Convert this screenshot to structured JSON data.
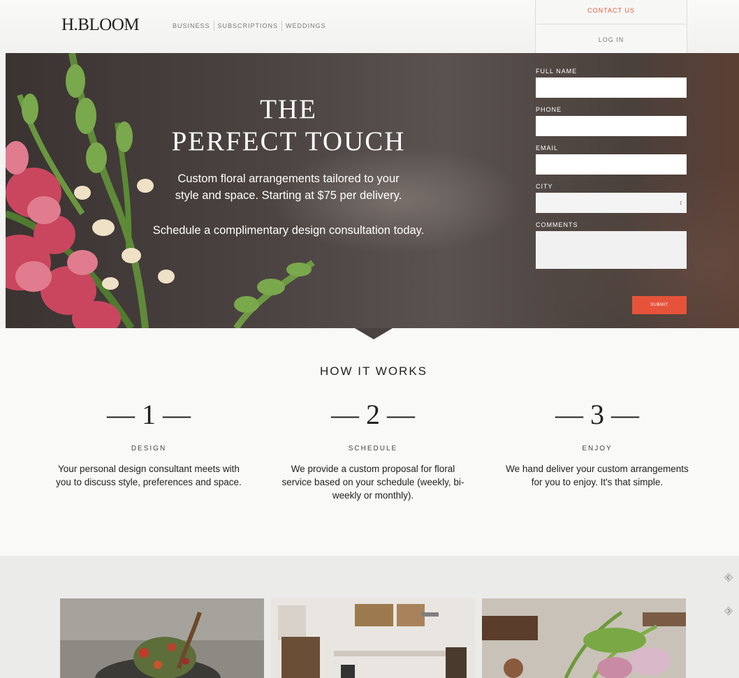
{
  "header": {
    "logo": "H.BLOOM",
    "nav": [
      "BUSINESS",
      "SUBSCRIPTIONS",
      "WEDDINGS"
    ],
    "contact_label": "CONTACT US",
    "login_label": "LOG IN"
  },
  "hero": {
    "title_line1": "THE",
    "title_line2": "PERFECT TOUCH",
    "subtitle_line1": "Custom floral arrangements tailored to your",
    "subtitle_line2": "style and space. Starting at $75 per delivery.",
    "cta": "Schedule a complimentary design consultation today."
  },
  "form": {
    "full_name_label": "FULL NAME",
    "phone_label": "PHONE",
    "email_label": "EMAIL",
    "city_label": "CITY",
    "comments_label": "COMMENTS",
    "submit_label": "SUBMIT"
  },
  "how": {
    "title": "HOW IT WORKS",
    "steps": [
      {
        "number": "— 1 —",
        "label": "DESIGN",
        "desc": "Your personal design consultant meets with you to discuss style, preferences and space."
      },
      {
        "number": "— 2 —",
        "label": "SCHEDULE",
        "desc": "We provide a custom proposal for floral service based on your schedule (weekly, bi-weekly or monthly)."
      },
      {
        "number": "— 3 —",
        "label": "ENJOY",
        "desc": "We hand deliver your custom arrangements for you to enjoy. It's that simple."
      }
    ]
  },
  "colors": {
    "accent": "#e6533a",
    "hero_bg": "#4a4240"
  },
  "icons": [
    "chevron-left-icon",
    "chevron-right-icon",
    "select-arrow-icon"
  ]
}
